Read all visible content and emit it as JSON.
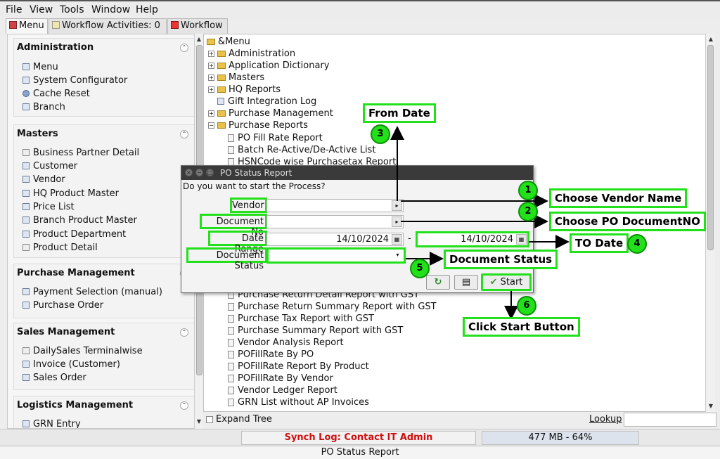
{
  "menubar": {
    "items": [
      "File",
      "View",
      "Tools",
      "Window",
      "Help"
    ]
  },
  "tabs": [
    {
      "label": "Menu"
    },
    {
      "label": "Workflow Activities: 0"
    },
    {
      "label": "Workflow"
    }
  ],
  "sidebar": {
    "sections": [
      {
        "title": "Administration",
        "items": [
          "Menu",
          "System Configurator",
          "Cache Reset",
          "Branch"
        ]
      },
      {
        "title": "Masters",
        "items": [
          "Business Partner Detail",
          "Customer",
          "Vendor",
          "HQ Product Master",
          "Price List",
          "Branch Product Master",
          "Product Department",
          "Product Detail"
        ]
      },
      {
        "title": "Purchase Management",
        "items": [
          "Payment Selection (manual)",
          "Purchase Order"
        ]
      },
      {
        "title": "Sales Management",
        "items": [
          "DailySales Terminalwise",
          "Invoice (Customer)",
          "Sales Order"
        ]
      },
      {
        "title": "Logistics Management",
        "items": [
          "GRN Entry"
        ]
      }
    ]
  },
  "tree": {
    "root": "&Menu",
    "nodes": [
      {
        "label": "Administration"
      },
      {
        "label": "Application Dictionary"
      },
      {
        "label": "Masters"
      },
      {
        "label": "HQ Reports"
      },
      {
        "label": "Gift Integration Log"
      },
      {
        "label": "Purchase Management"
      },
      {
        "label": "Purchase Reports"
      }
    ],
    "reports_top": [
      "PO Fill Rate Report",
      "Batch Re-Active/De-Active List",
      "HSNCode wise Purchasetax Report"
    ],
    "reports_bottom": [
      "Purchase Return Detail Report with GST",
      "Purchase Return Summary Report with GST",
      "Purchase Tax Report with GST",
      "Purchase Summary Report with GST",
      "Vendor Analysis Report",
      "POFillRate By PO",
      "POFillRate Report By Product",
      "POFillRate By Vendor",
      "Vendor Ledger Report",
      "GRN List without AP Invoices"
    ]
  },
  "bottom": {
    "expand_tree": "Expand Tree",
    "lookup": "Lookup",
    "synch_log": "Synch Log: Contact IT Admin",
    "memory": "477 MB - 64%",
    "footer": "PO Status Report"
  },
  "dialog": {
    "title": "PO Status Report",
    "question": "Do you want to start the Process?",
    "vendor_label": "Vendor",
    "vendor_value": "",
    "docno_label": "Document No",
    "docno_value": "",
    "daterange_label": "Date Range",
    "date_from": "14/10/2024",
    "date_to": "14/10/2024",
    "docstatus_label": "Document Status",
    "docstatus_value": "",
    "start_label": "Start"
  },
  "annotations": {
    "vendor": {
      "num": "1",
      "text": "Choose Vendor Name"
    },
    "docno": {
      "num": "2",
      "text": "Choose PO DocumentNO"
    },
    "fromdate": {
      "num": "3",
      "text": "From Date"
    },
    "todate": {
      "num": "4",
      "text": "TO Date"
    },
    "status": {
      "num": "5",
      "text": "Document Status"
    },
    "start": {
      "num": "6",
      "text": "Click Start Button"
    }
  },
  "colors": {
    "annotation_green": "#22e01a",
    "synch_red": "#d01010"
  }
}
